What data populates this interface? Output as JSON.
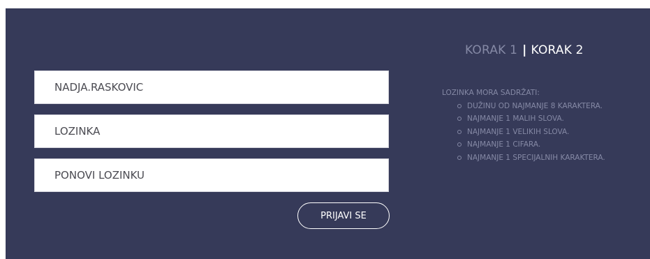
{
  "steps": {
    "step1_label": "KORAK 1",
    "separator": "|",
    "step2_label": "KORAK 2"
  },
  "form": {
    "username_value": "NADJA.RASKOVIC",
    "password_placeholder": "LOZINKA",
    "password_repeat_placeholder": "PONOVI LOZINKU",
    "submit_label": "PRIJAVI SE"
  },
  "rules": {
    "heading": "LOZINKA MORA SADRŽATI:",
    "items": [
      {
        "label": "DUŽINU OD NAJMANJE 8 KARAKTERA."
      },
      {
        "label": "NAJMANJE 1 MALIH SLOVA."
      },
      {
        "label": "NAJMANJE 1 VELIKIH SLOVA."
      },
      {
        "label": "NAJMANJE 1 CIFARA."
      },
      {
        "label": "NAJMANJE 1 SPECIJALNIH KARAKTERA."
      }
    ]
  },
  "colors": {
    "panel_background": "#363a59",
    "inactive_text": "#8589a5",
    "active_text": "#ffffff"
  }
}
